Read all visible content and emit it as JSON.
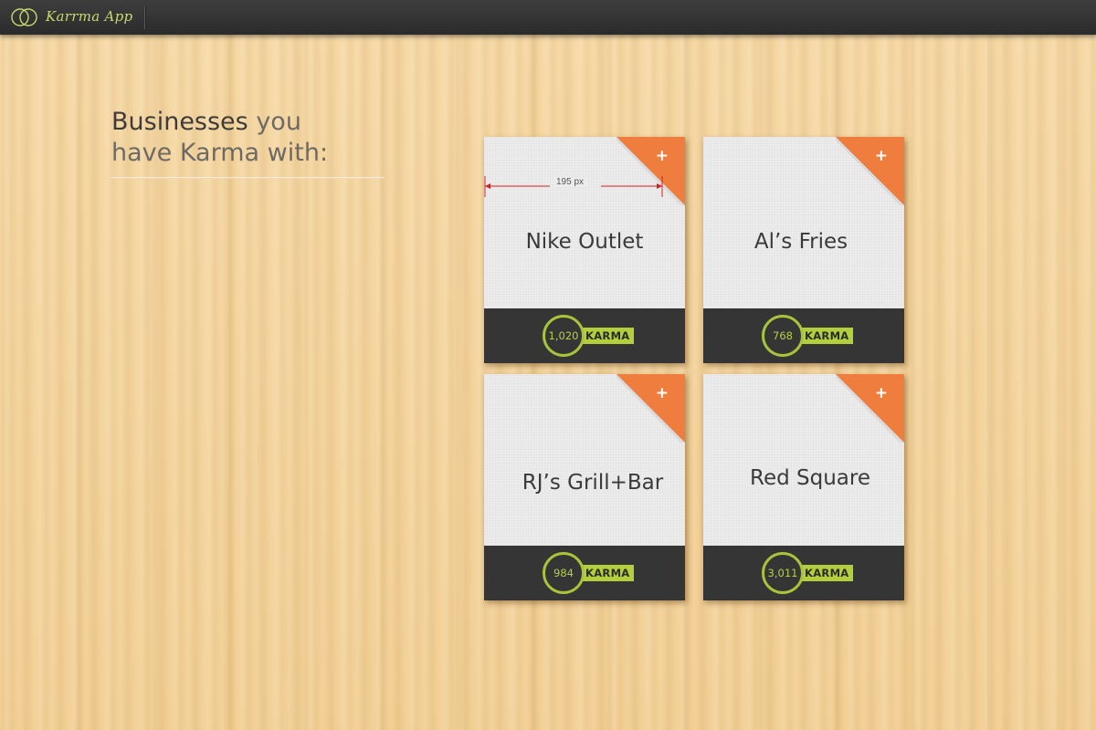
{
  "app": {
    "title": "Karrma App"
  },
  "heading": {
    "line1_strong": "Businesses",
    "line1_rest": " you",
    "line2": "have Karma with:"
  },
  "annotation": {
    "dimension_label": "195 px"
  },
  "colors": {
    "accent_orange": "#ee7d3e",
    "karma_green": "#b4cf3c",
    "footer_dark": "#353535",
    "topbar_dark": "#333333",
    "annotation_red": "#d42020"
  },
  "cards": [
    {
      "name": "Nike Outlet",
      "karma": "1,020",
      "karma_label": "KARMA",
      "add_icon": "+"
    },
    {
      "name": "Al’s Fries",
      "karma": "768",
      "karma_label": "KARMA",
      "add_icon": "+"
    },
    {
      "name": "RJ’s Grill+Bar",
      "karma": "984",
      "karma_label": "KARMA",
      "add_icon": "+"
    },
    {
      "name": "Red Square",
      "karma": "3,011",
      "karma_label": "KARMA",
      "add_icon": "+"
    }
  ]
}
